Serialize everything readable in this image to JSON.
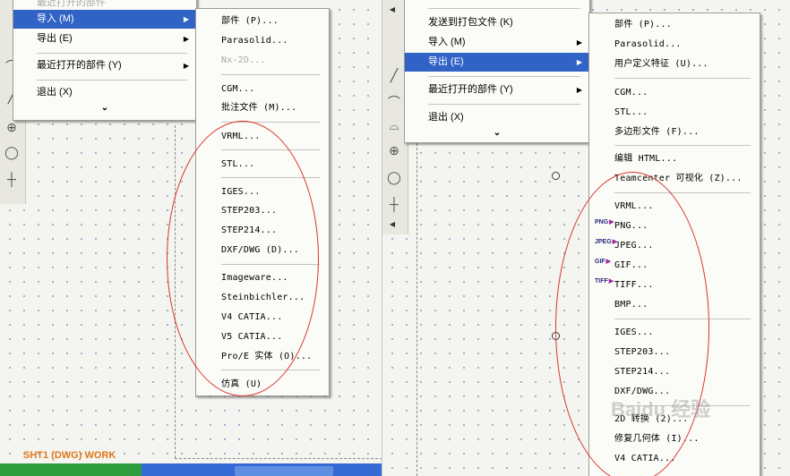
{
  "left": {
    "main_menu": {
      "items": [
        {
          "label": "最近打开的部件"
        },
        {
          "label": "导入 (M)"
        },
        {
          "label": "导出 (E)"
        },
        {
          "label": "最近打开的部件 (Y)"
        },
        {
          "label": "退出 (X)"
        }
      ],
      "more": "⌄"
    },
    "submenu": [
      {
        "label": "部件 (P)..."
      },
      {
        "label": "Parasolid..."
      },
      {
        "label": "Nx-2D..."
      },
      {
        "label": "CGM..."
      },
      {
        "label": "批注文件 (M)..."
      },
      {
        "label": "VRML..."
      },
      {
        "label": "STL..."
      },
      {
        "label": "IGES..."
      },
      {
        "label": "STEP203..."
      },
      {
        "label": "STEP214..."
      },
      {
        "label": "DXF/DWG (D)..."
      },
      {
        "label": "Imageware..."
      },
      {
        "label": "Steinbichler..."
      },
      {
        "label": "V4 CATIA..."
      },
      {
        "label": "V5 CATIA..."
      },
      {
        "label": "Pro/E 实体 (O)..."
      },
      {
        "label": "仿真 (U)"
      }
    ],
    "status": "SHT1 (DWG) WORK"
  },
  "right": {
    "main_menu": {
      "items": [
        {
          "label": "发送到打包文件 (K)"
        },
        {
          "label": "导入 (M)"
        },
        {
          "label": "导出 (E)"
        },
        {
          "label": "最近打开的部件 (Y)"
        },
        {
          "label": "退出 (X)"
        }
      ],
      "more": "⌄"
    },
    "submenu": [
      {
        "label": "部件 (P)..."
      },
      {
        "label": "Parasolid..."
      },
      {
        "label": "用户定义特征 (U)..."
      },
      {
        "label": "CGM..."
      },
      {
        "label": "STL..."
      },
      {
        "label": "多边形文件 (F)..."
      },
      {
        "label": "编辑 HTML..."
      },
      {
        "label": "Teamcenter 可视化 (Z)..."
      },
      {
        "label": "VRML..."
      },
      {
        "label": "PNG..."
      },
      {
        "label": "JPEG..."
      },
      {
        "label": "GIF..."
      },
      {
        "label": "TIFF..."
      },
      {
        "label": "BMP..."
      },
      {
        "label": "IGES..."
      },
      {
        "label": "STEP203..."
      },
      {
        "label": "STEP214..."
      },
      {
        "label": "DXF/DWG..."
      },
      {
        "label": "2D 转换 (2)..."
      },
      {
        "label": "修复几何体 (I)..."
      },
      {
        "label": "V4 CATIA..."
      }
    ],
    "format_icons": [
      "PNG",
      "JPEG",
      "GIF",
      "TIFF"
    ]
  },
  "watermark": "Baidu 经验",
  "colors": {
    "highlight": "#3163c6",
    "ellipse": "#d8342c",
    "status": "#e07a1a"
  }
}
